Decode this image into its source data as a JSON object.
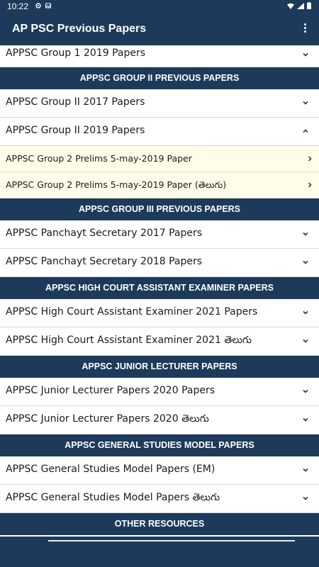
{
  "status_bar": {
    "time": "10:22"
  },
  "app_bar": {
    "title": "AP PSC Previous Papers"
  },
  "first_row": {
    "label": "APPSC Group 1 2019 Papers"
  },
  "sections": [
    {
      "header": "APPSC GROUP II PREVIOUS PAPERS",
      "rows": [
        {
          "label": "APPSC Group II 2017 Papers",
          "expanded": false
        },
        {
          "label": "APPSC Group II 2019 Papers",
          "expanded": true
        }
      ],
      "subitems": [
        {
          "label": "APPSC Group 2 Prelims 5-may-2019 Paper"
        },
        {
          "label": "APPSC Group 2 Prelims 5-may-2019 Paper (తెలుగు)"
        }
      ]
    },
    {
      "header": "APPSC GROUP III PREVIOUS PAPERS",
      "rows": [
        {
          "label": "APPSC Panchayt Secretary 2017 Papers",
          "expanded": false
        },
        {
          "label": "APPSC Panchayt Secretary 2018 Papers",
          "expanded": false
        }
      ]
    },
    {
      "header": "APPSC HIGH COURT ASSISTANT EXAMINER PAPERS",
      "rows": [
        {
          "label": "APPSC High Court Assistant Examiner 2021 Papers",
          "expanded": false
        },
        {
          "label": "APPSC High Court Assistant Examiner 2021 తెలుగు",
          "expanded": false
        }
      ]
    },
    {
      "header": "APPSC JUNIOR LECTURER PAPERS",
      "rows": [
        {
          "label": "APPSC Junior Lecturer Papers 2020 Papers",
          "expanded": false
        },
        {
          "label": "APPSC Junior Lecturer Papers 2020 తెలుగు",
          "expanded": false
        }
      ]
    },
    {
      "header": "APPSC GENERAL STUDIES MODEL PAPERS",
      "rows": [
        {
          "label": "APPSC General Studies Model Papers (EM)",
          "expanded": false
        },
        {
          "label": "APPSC General Studies Model Papers తెలుగు",
          "expanded": false
        }
      ]
    },
    {
      "header": "OTHER RESOURCES",
      "rows": []
    }
  ],
  "colors": {
    "primary": "#1d3a5b",
    "subitem_bg": "#fffde8"
  },
  "icons": {
    "expand": "chevron-down-icon",
    "collapse": "chevron-up-icon",
    "open": "chevron-right-icon"
  }
}
